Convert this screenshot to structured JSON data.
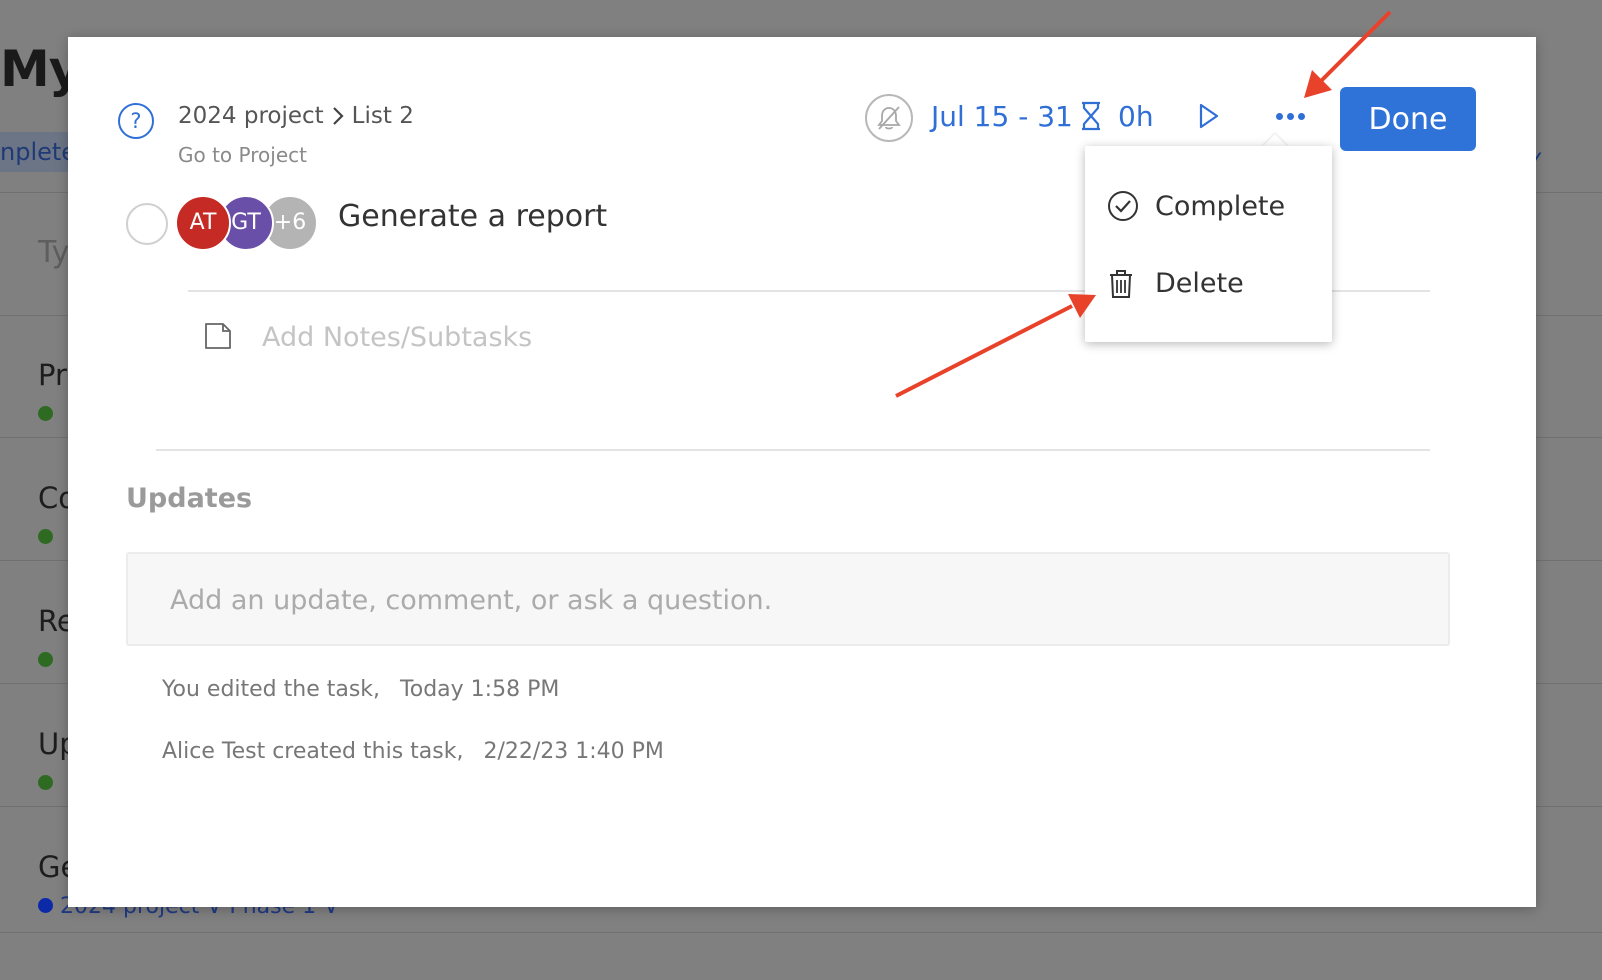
{
  "background": {
    "page_title": "My",
    "tab_label": "nplete",
    "right_text": "Y",
    "input_placeholder": "Ty",
    "rows": [
      {
        "title": "Pr",
        "sub": ""
      },
      {
        "title": "Co",
        "sub": ""
      },
      {
        "title": "Re",
        "sub": ""
      },
      {
        "title": "Up",
        "sub": ""
      },
      {
        "title": "Ge",
        "sub": "2024 project ∨ Phase 1  ∨"
      }
    ]
  },
  "header": {
    "breadcrumb": {
      "project": "2024 project",
      "list": "List 2"
    },
    "go_to_project": "Go to Project",
    "date_range": "Jul 15 - 31",
    "hours": "0h",
    "done_label": "Done"
  },
  "task": {
    "title": "Generate a report",
    "avatars": [
      {
        "initials": "AT",
        "color": "#c62a24"
      },
      {
        "initials": "GT",
        "color": "#6a4fa8"
      },
      {
        "initials": "+6",
        "color": "#b4b4b4"
      }
    ],
    "notes_placeholder": "Add Notes/Subtasks"
  },
  "updates": {
    "heading": "Updates",
    "input_placeholder": "Add an update, comment, or ask a question.",
    "activity": [
      {
        "text": "You edited the task,",
        "time": "Today 1:58 PM"
      },
      {
        "text": "Alice Test created this task,",
        "time": "2/22/23 1:40 PM"
      }
    ]
  },
  "menu": {
    "items": [
      {
        "label": "Complete",
        "icon": "check-circle-icon"
      },
      {
        "label": "Delete",
        "icon": "trash-icon"
      }
    ]
  },
  "colors": {
    "accent": "#2f6fd6",
    "done_button": "#2f72d8",
    "annotation_arrow": "#e8422a"
  }
}
